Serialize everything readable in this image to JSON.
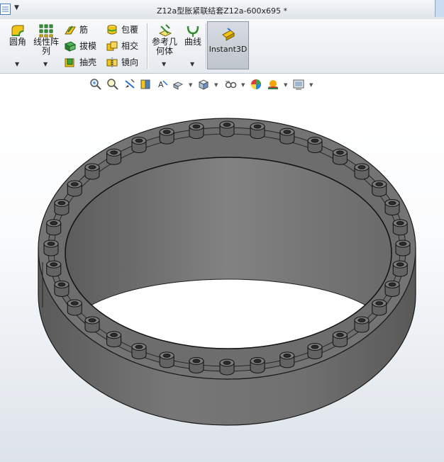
{
  "window": {
    "title": "Z12a型胀紧联结套Z12a-600x695 *"
  },
  "ribbon": {
    "fillet": {
      "label": "圆角"
    },
    "linear_pattern": {
      "label_line1": "线性阵",
      "label_line2": "列"
    },
    "rib": {
      "label": "筋"
    },
    "draft": {
      "label": "拔模"
    },
    "shell": {
      "label": "抽壳"
    },
    "wrap": {
      "label": "包覆"
    },
    "intersect": {
      "label": "相交"
    },
    "mirror": {
      "label": "镜向"
    },
    "ref_geometry": {
      "label_line1": "参考几",
      "label_line2": "何体"
    },
    "curves": {
      "label": "曲线"
    },
    "instant3d": {
      "label": "Instant3D",
      "active": true
    }
  },
  "heads_up_toolbar": {
    "icons": [
      "zoom-to-fit-icon",
      "zoom-to-area-icon",
      "previous-view-icon",
      "section-view-icon",
      "dynamic-annotation-icon",
      "view-orientation-icon",
      "display-style-icon",
      "hide-show-items-icon",
      "edit-appearance-icon",
      "apply-scene-icon",
      "view-settings-icon"
    ]
  },
  "model": {
    "bolt_count": 36,
    "color": "#6f6f6f"
  }
}
